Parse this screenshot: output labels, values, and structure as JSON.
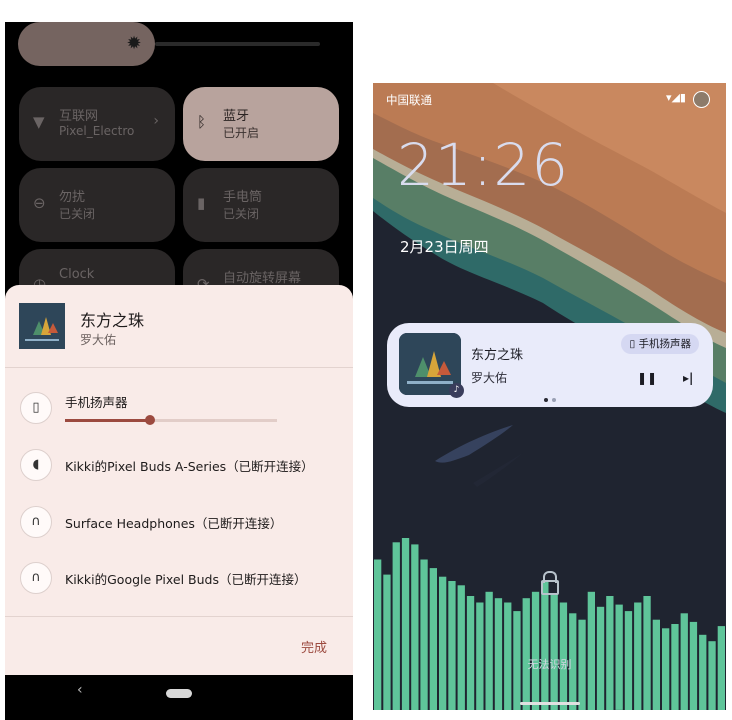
{
  "left": {
    "tiles": [
      {
        "title": "互联网",
        "subtitle": "Pixel_Electro",
        "icon": "wifi-icon",
        "active": false
      },
      {
        "title": "蓝牙",
        "subtitle": "已开启",
        "icon": "bluetooth-icon",
        "active": true
      },
      {
        "title": "勿扰",
        "subtitle": "已关闭",
        "icon": "dnd-icon",
        "active": false
      },
      {
        "title": "手电筒",
        "subtitle": "已关闭",
        "icon": "flashlight-icon",
        "active": false
      },
      {
        "title": "Clock",
        "subtitle": "",
        "icon": "clock-icon",
        "active": false
      },
      {
        "title": "自动旋转屏幕",
        "subtitle": "",
        "icon": "rotate-icon",
        "active": false
      }
    ],
    "sheet": {
      "song_title": "东方之珠",
      "artist": "罗大佑",
      "devices": [
        {
          "label": "手机扬声器",
          "icon": "phone-speaker-icon"
        },
        {
          "label": "Kikki的Pixel Buds A-Series（已断开连接）",
          "icon": "earbud-icon"
        },
        {
          "label": "Surface Headphones（已断开连接）",
          "icon": "headphones-icon"
        },
        {
          "label": "Kikki的Google Pixel Buds（已断开连接）",
          "icon": "headphones-icon"
        }
      ],
      "volume_fraction": 0.4,
      "done_label": "完成"
    },
    "colors": {
      "accent": "#9c4a3f",
      "sheet_bg": "#f9ebe8",
      "active_tile": "#b8a39d"
    }
  },
  "right": {
    "carrier": "中国联通",
    "clock": "21:26",
    "date": "2月23日周四",
    "media": {
      "title": "东方之珠",
      "artist": "罗大佑",
      "output_label": "手机扬声器",
      "pause_icon": "pause-icon",
      "next_icon": "skip-next-icon"
    },
    "unlock_text": "无法识别",
    "colors": {
      "card_bg": "#e9ebfa",
      "equalizer": "#5fc59a"
    },
    "equalizer_levels": [
      0.7,
      0.63,
      0.78,
      0.8,
      0.77,
      0.7,
      0.66,
      0.62,
      0.6,
      0.58,
      0.53,
      0.5,
      0.55,
      0.52,
      0.5,
      0.46,
      0.52,
      0.55,
      0.6,
      0.54,
      0.5,
      0.45,
      0.42,
      0.55,
      0.48,
      0.53,
      0.49,
      0.46,
      0.5,
      0.53,
      0.42,
      0.38,
      0.4,
      0.45,
      0.41,
      0.35,
      0.32,
      0.39
    ]
  }
}
